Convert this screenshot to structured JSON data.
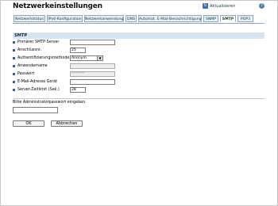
{
  "page": {
    "title": "Netzwerkeinstellungen",
    "refresh_label": "Aktualisieren",
    "refresh_icon": "refresh-icon",
    "help_icon": "help-icon"
  },
  "tabs": [
    {
      "label": "Netzwerkstatus"
    },
    {
      "label": "IPv6-Konfiguration"
    },
    {
      "label": "Netzwerkanwendung"
    },
    {
      "label": "DNS"
    },
    {
      "label": "Automat. E-Mail-Benachrichtigung"
    },
    {
      "label": "SNMP"
    },
    {
      "label": "SMTP"
    },
    {
      "label": "POP3"
    }
  ],
  "active_tab": "SMTP",
  "section": {
    "title": "SMTP"
  },
  "form": {
    "primary_smtp_label": "Primärer SMTP-Server",
    "primary_smtp_value": "",
    "port_label": "Anschlussnr.",
    "port_value": "25",
    "auth_label": "Authentifizierungsmethode",
    "auth_value": "Anonym",
    "username_label": "Anwendername",
    "username_value": "",
    "password_label": "Passwort",
    "password_value": "*******",
    "email_label": "E-Mail-Adresse Gerät",
    "email_value": "",
    "timeout_label": "Server-Zeitlimit (Sek.)",
    "timeout_value": "28"
  },
  "admin": {
    "prompt": "Bitte Administratorpasswort eingeben.",
    "password_value": ""
  },
  "buttons": {
    "ok": "OK",
    "cancel": "Abbrechen"
  },
  "colors": {
    "accent": "#3d5d8c",
    "tab_border": "#8fa7c4",
    "section_bg": "#d9e4f1"
  }
}
